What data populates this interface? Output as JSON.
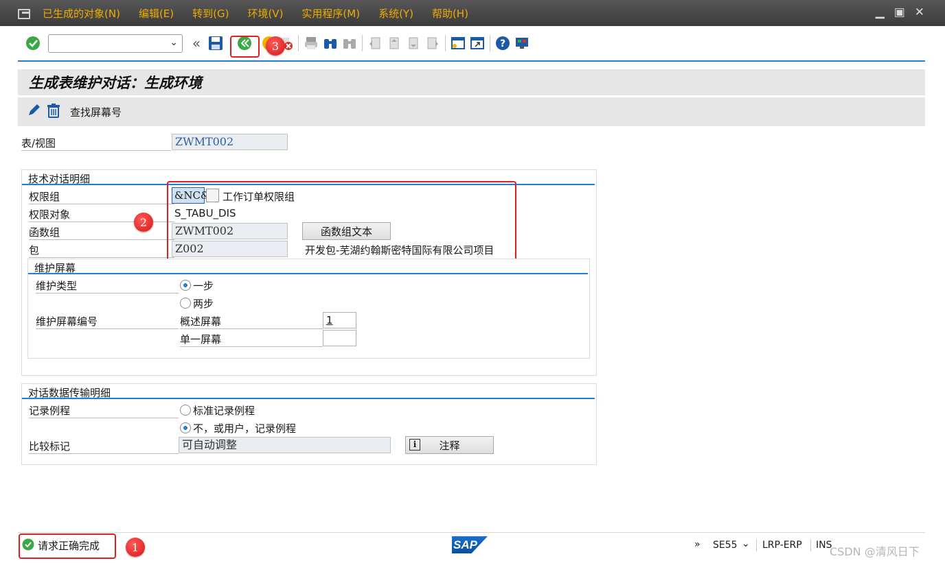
{
  "menubar": {
    "items": [
      "已生成的对象(N)",
      "编辑(E)",
      "转到(G)",
      "环境(V)",
      "实用程序(M)",
      "系统(Y)",
      "帮助(H)"
    ]
  },
  "toolbar": {
    "command_value": "",
    "icons": [
      "check-icon",
      "save-icon",
      "back-icon",
      "exit-icon",
      "cancel-icon",
      "print-icon",
      "find-icon",
      "find-next-icon",
      "first-page-icon",
      "prev-page-icon",
      "next-page-icon",
      "last-page-icon",
      "new-session-icon",
      "shortcut-icon",
      "help-icon",
      "customize-icon"
    ]
  },
  "annotations": {
    "badge1": "1",
    "badge2": "2",
    "badge3": "3"
  },
  "title": "生成表维护对话：生成环境",
  "app_toolbar": {
    "find_screen": "查找屏幕号"
  },
  "table_view": {
    "label": "表/视图",
    "value": "ZWMT002"
  },
  "tech_details": {
    "title": "技术对话明细",
    "auth_group_label": "权限组",
    "auth_group_value": "&NC&",
    "auth_group_text": "工作订单权限组",
    "auth_object_label": "权限对象",
    "auth_object_value": "S_TABU_DIS",
    "function_group_label": "函数组",
    "function_group_value": "ZWMT002",
    "function_group_button": "函数组文本",
    "package_label": "包",
    "package_value": "Z002",
    "package_text": "开发包-芜湖约翰斯密特国际有限公司项目"
  },
  "maint_screen": {
    "title": "维护屏幕",
    "type_label": "维护类型",
    "one_step": "一步",
    "two_step": "两步",
    "screen_no_label": "维护屏幕编号",
    "overview_label": "概述屏幕",
    "overview_value": "1",
    "single_label": "单一屏幕",
    "single_value": ""
  },
  "transport": {
    "title": "对话数据传输明细",
    "routine_label": "记录例程",
    "standard_routine": "标准记录例程",
    "no_routine": "不，或用户，记录例程",
    "compare_label": "比较标记",
    "compare_value": "可自动调整",
    "note_button": "注释"
  },
  "statusbar": {
    "message": "请求正确完成",
    "tcode": "SE55",
    "system": "LRP-ERP",
    "mode": "INS",
    "watermark": "CSDN @清风日下"
  },
  "colors": {
    "accent": "#1f7fd8",
    "menu_text": "#f0ab00",
    "highlight": "#e02020"
  }
}
